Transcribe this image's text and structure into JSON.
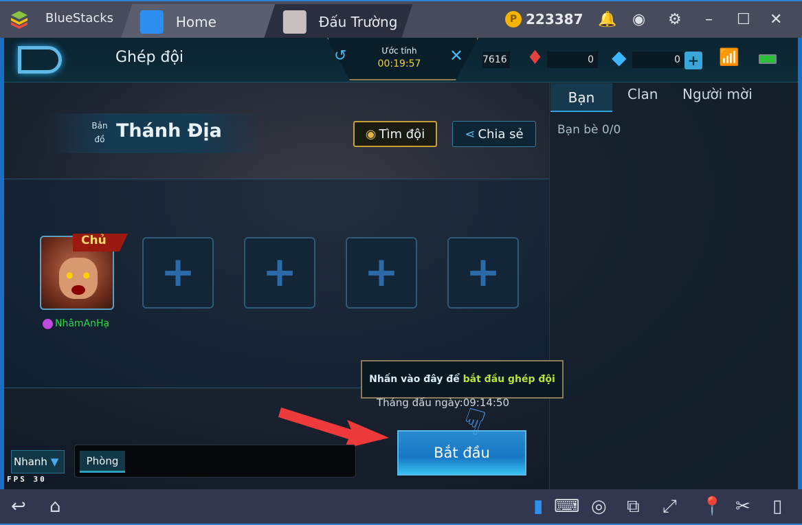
{
  "titlebar": {
    "brand": "BlueStacks",
    "tabs": [
      {
        "label": "Home"
      },
      {
        "label": "Đấu Trường"
      }
    ],
    "coins": "223387",
    "icons": [
      "bell-icon",
      "account-icon",
      "gear-icon",
      "minimize-icon",
      "maximize-icon",
      "close-icon"
    ]
  },
  "game": {
    "header": {
      "title": "Ghép đội",
      "estimate_label": "Ước tính",
      "estimate_time": "00:19:57",
      "gold": "7616",
      "crystals": "0",
      "diamonds": "0"
    },
    "map": {
      "label": "Bản đồ",
      "name": "Thánh Địa"
    },
    "find_team": "Tìm đội",
    "share": "Chia sẻ",
    "side_tabs": [
      "Bạn",
      "Clan",
      "Người mời"
    ],
    "friends": "Bạn bè 0/0",
    "leader_badge": "Chủ",
    "player_name": "NhâmAnHạ",
    "slot_plus": "+",
    "tooltip": {
      "text": "Nhấn vào đây để ",
      "highlight": "bắt đầu ghép đội"
    },
    "season": "Tháng đấu ngày:09:14:50",
    "start": "Bắt đầu",
    "mode": "Nhanh",
    "room": "Phòng",
    "fps": "FPS 30"
  },
  "colors": {
    "accent": "#2d7fd8",
    "highlight": "#b6e43a",
    "timer": "#f0d13a",
    "player": "#29d84a"
  }
}
